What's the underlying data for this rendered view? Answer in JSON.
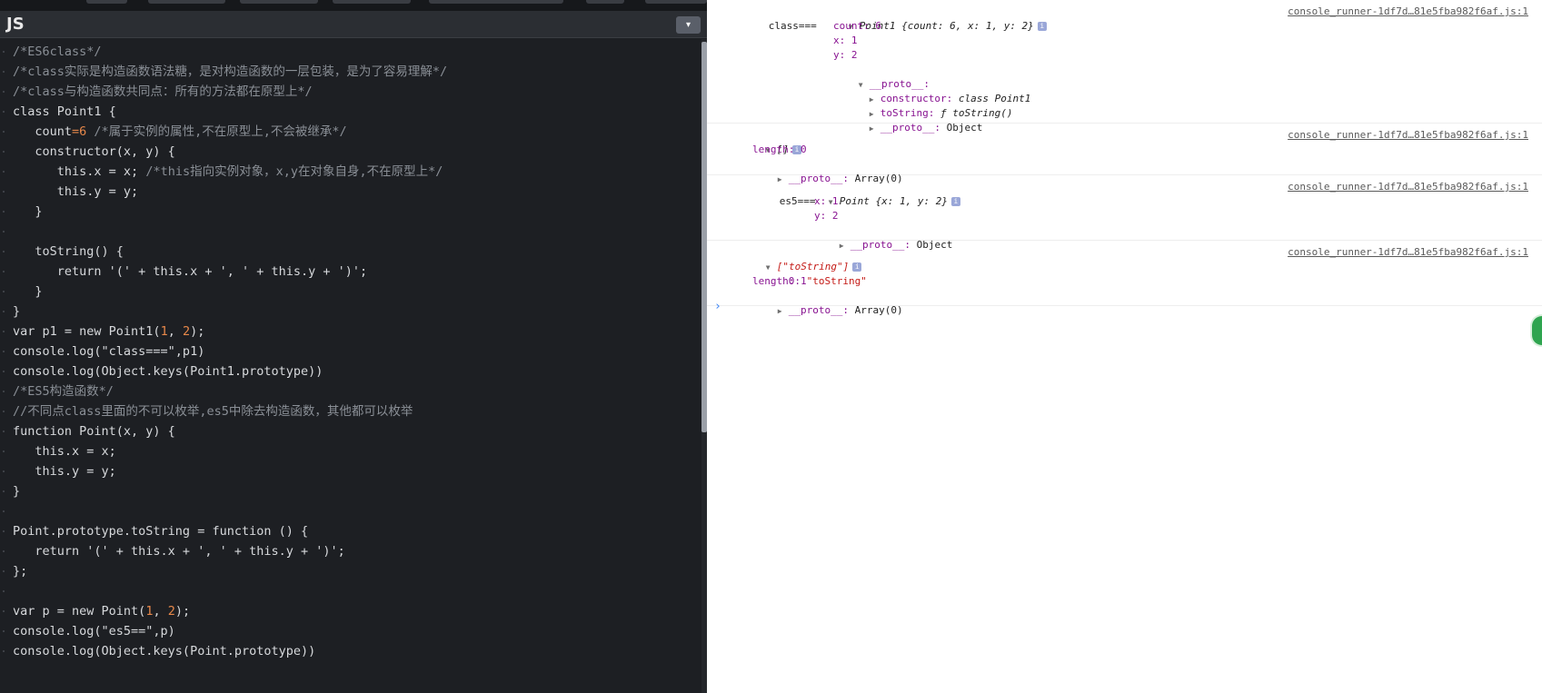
{
  "editor": {
    "title": "JS",
    "collapse_icon": "▾",
    "code_lines": [
      [
        {
          "t": "/*ES6class*/",
          "c": "com"
        }
      ],
      [
        {
          "t": "/*class实际是构造函数语法糖，是对构造函数的一层包装，是为了容易理解*/",
          "c": "com"
        }
      ],
      [
        {
          "t": "/*class与构造函数共同点：所有的方法都在原型上*/",
          "c": "com"
        }
      ],
      [
        {
          "t": "class Point1 {",
          "c": ""
        }
      ],
      [
        {
          "t": "   count",
          "c": ""
        },
        {
          "t": "=6",
          "c": "num"
        },
        {
          "t": " /*属于实例的属性,不在原型上,不会被继承*/",
          "c": "com"
        }
      ],
      [
        {
          "t": "   constructor(x, y) {",
          "c": ""
        }
      ],
      [
        {
          "t": "      this.x = x; ",
          "c": ""
        },
        {
          "t": "/*this指向实例对象，x,y在对象自身,不在原型上*/",
          "c": "com"
        }
      ],
      [
        {
          "t": "      this.y = y;",
          "c": ""
        }
      ],
      [
        {
          "t": "   }",
          "c": ""
        }
      ],
      [
        {
          "t": "",
          "c": ""
        }
      ],
      [
        {
          "t": "   toString() {",
          "c": ""
        }
      ],
      [
        {
          "t": "      return '(' + this.x + ', ' + this.y + ')';",
          "c": ""
        }
      ],
      [
        {
          "t": "   }",
          "c": ""
        }
      ],
      [
        {
          "t": "}",
          "c": ""
        }
      ],
      [
        {
          "t": "var p1 = new Point1(",
          "c": ""
        },
        {
          "t": "1",
          "c": "num"
        },
        {
          "t": ", ",
          "c": ""
        },
        {
          "t": "2",
          "c": "num"
        },
        {
          "t": ");",
          "c": ""
        }
      ],
      [
        {
          "t": "console.log(\"class===\",p1)",
          "c": ""
        }
      ],
      [
        {
          "t": "console.log(Object.keys(Point1.prototype))",
          "c": ""
        }
      ],
      [
        {
          "t": "/*ES5构造函数*/",
          "c": "com"
        }
      ],
      [
        {
          "t": "//不同点class里面的不可以枚举,es5中除去构造函数，其他都可以枚举",
          "c": "com"
        }
      ],
      [
        {
          "t": "function Point(x, y) {",
          "c": ""
        }
      ],
      [
        {
          "t": "   this.x = x;",
          "c": ""
        }
      ],
      [
        {
          "t": "   this.y = y;",
          "c": ""
        }
      ],
      [
        {
          "t": "}",
          "c": ""
        }
      ],
      [
        {
          "t": "",
          "c": ""
        }
      ],
      [
        {
          "t": "Point.prototype.toString = function () {",
          "c": ""
        }
      ],
      [
        {
          "t": "   return '(' + this.x + ', ' + this.y + ')';",
          "c": ""
        }
      ],
      [
        {
          "t": "};",
          "c": ""
        }
      ],
      [
        {
          "t": "",
          "c": ""
        }
      ],
      [
        {
          "t": "var p = new Point(",
          "c": ""
        },
        {
          "t": "1",
          "c": "num"
        },
        {
          "t": ", ",
          "c": ""
        },
        {
          "t": "2",
          "c": "num"
        },
        {
          "t": ");",
          "c": ""
        }
      ],
      [
        {
          "t": "console.log(\"es5==\",p)",
          "c": ""
        }
      ],
      [
        {
          "t": "console.log(Object.keys(Point.prototype))",
          "c": ""
        }
      ]
    ]
  },
  "console": {
    "source_link": "console_runner-1df7d…81e5fba982f6af.js:1",
    "entry1": {
      "label": "class===",
      "summary": "Point1 {count: 6, x: 1, y: 2}",
      "count": "count: 6",
      "x": "x: 1",
      "y": "y: 2",
      "proto": "__proto__:",
      "constructor_key": "constructor:",
      "constructor_val": "class Point1",
      "tostring_key": "toString:",
      "tostring_val": "ƒ toString()",
      "proto2_key": "__proto__:",
      "proto2_val": "Object"
    },
    "entry2": {
      "summary": "[]",
      "length": "length: 0",
      "proto_key": "__proto__:",
      "proto_val": "Array(0)"
    },
    "entry3": {
      "label": "es5===",
      "summary": "Point {x: 1, y: 2}",
      "x": "x: 1",
      "y": "y: 2",
      "proto_key": "__proto__:",
      "proto_val": "Object"
    },
    "entry4": {
      "summary": "[\"toString\"]",
      "item0_key": "0:",
      "item0_val": "\"toString\"",
      "length": "length: 1",
      "proto_key": "__proto__:",
      "proto_val": "Array(0)"
    },
    "prompt": "›"
  }
}
